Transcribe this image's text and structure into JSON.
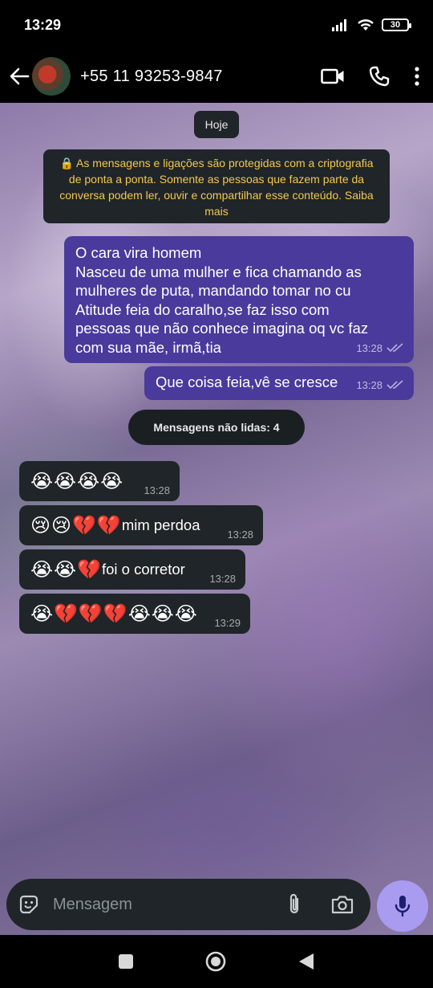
{
  "status_bar": {
    "time": "13:29",
    "battery": "30"
  },
  "header": {
    "contact": "+55 11 93253-9847"
  },
  "chat": {
    "date_label": "Hoje",
    "encryption_notice": "🔒 As mensagens e ligações são protegidas com a criptografia de ponta a ponta. Somente as pessoas que fazem parte da conversa podem ler, ouvir e compartilhar esse conteúdo. Saiba mais",
    "outgoing": [
      {
        "lines": [
          "O cara vira homem",
          "Nasceu de uma mulher e fica chamando as",
          "mulheres de puta, mandando tomar no cu",
          "Atitude feia do caralho,se faz isso com",
          "pessoas que não conhece imagina oq vc faz",
          "com sua mãe, irmã,tia"
        ],
        "time": "13:28"
      },
      {
        "text": "Que coisa feia,vê se cresce",
        "time": "13:28"
      }
    ],
    "unread_label": "Mensagens não lidas: 4",
    "incoming": [
      {
        "emoji": "😭😭😭😭",
        "text": "",
        "time": "13:28"
      },
      {
        "emoji": "😢😢💔💔",
        "text": "mim perdoa",
        "time": "13:28"
      },
      {
        "emoji": "😭😭💔",
        "text": "foi o corretor",
        "time": "13:28"
      },
      {
        "emoji": "😭💔💔💔😭😭😭",
        "text": "",
        "time": "13:29"
      }
    ]
  },
  "input": {
    "placeholder": "Mensagem"
  },
  "colors": {
    "outgoing_bubble": "#4a3a9c",
    "incoming_bubble": "#1f2528",
    "mic_button": "#a89bf0",
    "notice_text": "#f5c84c"
  }
}
